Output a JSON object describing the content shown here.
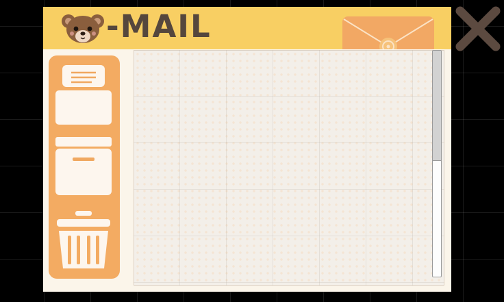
{
  "window": {
    "title": "-MAIL",
    "colors": {
      "header": "#f8cf63",
      "title_text": "#55473d",
      "sidebar": "#f3ab62",
      "envelope": "#f2a864",
      "close": "#5c4a40",
      "panel": "#fbf5ea"
    }
  },
  "header_icons": {
    "logo": "bear-face-icon",
    "decoration": "envelope-icon",
    "close": "close-icon"
  },
  "sidebar": {
    "items": [
      {
        "icon": "inbox-icon"
      },
      {
        "icon": "archive-box-icon"
      },
      {
        "icon": "trash-can-icon"
      }
    ]
  },
  "mail_list": {
    "items": []
  },
  "scrollbar": {
    "position_fraction": 0.0
  }
}
